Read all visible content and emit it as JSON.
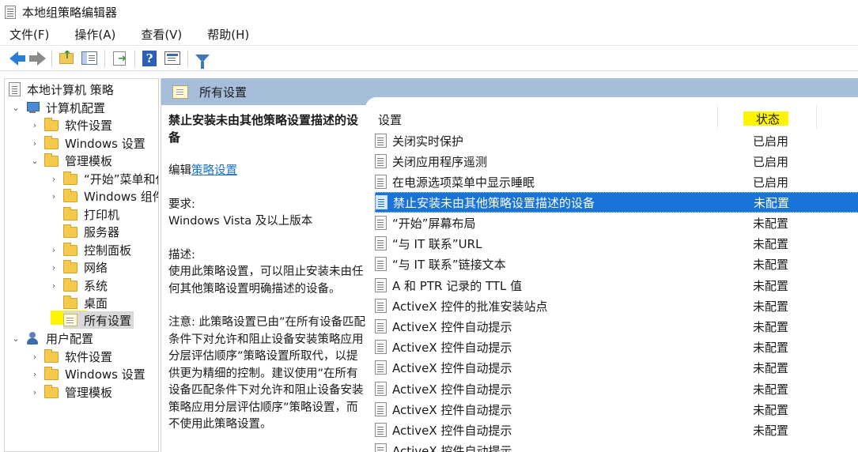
{
  "window": {
    "title": "本地组策略编辑器"
  },
  "menu": [
    "文件(F)",
    "操作(A)",
    "查看(V)",
    "帮助(H)"
  ],
  "toolbar": {
    "icons": [
      "back-arrow-icon",
      "forward-arrow-icon",
      "folder-up-icon",
      "show-hide-tree-icon",
      "export-list-icon",
      "help-icon",
      "properties-icon",
      "filter-icon"
    ]
  },
  "tree": {
    "root": "本地计算机 策略",
    "computer": "计算机配置",
    "c_software": "软件设置",
    "c_windows": "Windows 设置",
    "c_admin": "管理模板",
    "admin_children": [
      "“开始”菜单和任务栏",
      "Windows 组件",
      "打印机",
      "服务器",
      "控制面板",
      "网络",
      "系统",
      "桌面",
      "所有设置"
    ],
    "user": "用户配置",
    "u_software": "软件设置",
    "u_windows": "Windows 设置",
    "u_admin": "管理模板",
    "selected": "所有设置",
    "highlight_color": "#fff500"
  },
  "pane": {
    "header": "所有设置",
    "description": {
      "title": "禁止安装未由其他策略设置描述的设备",
      "edit_prefix": "编辑",
      "edit_link": "策略设置",
      "requirements_label": "要求:",
      "requirements": "Windows Vista 及以上版本",
      "desc_label": "描述:",
      "desc_text": "使用此策略设置，可以阻止安装未由任何其他策略设置明确描述的设备。",
      "note_text": "注意: 此策略设置已由”在所有设备匹配条件下对允许和阻止设备安装策略应用分层评估顺序”策略设置所取代，以提供更为精细的控制。建议使用”在所有设备匹配条件下对允许和阻止设备安装策略应用分层评估顺序”策略设置，而不使用此策略设置。"
    },
    "columns": {
      "setting": "设置",
      "status": "状态"
    },
    "rows": [
      {
        "name": "关闭实时保护",
        "state": "已启用"
      },
      {
        "name": "关闭应用程序遥测",
        "state": "已启用"
      },
      {
        "name": "在电源选项菜单中显示睡眠",
        "state": "已启用"
      },
      {
        "name": "禁止安装未由其他策略设置描述的设备",
        "state": "未配置"
      },
      {
        "name": "“开始”屏幕布局",
        "state": "未配置"
      },
      {
        "name": "“与 IT 联系”URL",
        "state": "未配置"
      },
      {
        "name": "“与 IT 联系”链接文本",
        "state": "未配置"
      },
      {
        "name": "A 和 PTR 记录的 TTL 值",
        "state": "未配置"
      },
      {
        "name": "ActiveX 控件的批准安装站点",
        "state": "未配置"
      },
      {
        "name": "ActiveX 控件自动提示",
        "state": "未配置"
      },
      {
        "name": "ActiveX 控件自动提示",
        "state": "未配置"
      },
      {
        "name": "ActiveX 控件自动提示",
        "state": "未配置"
      },
      {
        "name": "ActiveX 控件自动提示",
        "state": "未配置"
      },
      {
        "name": "ActiveX 控件自动提示",
        "state": "未配置"
      },
      {
        "name": "ActiveX 控件自动提示",
        "state": "未配置"
      },
      {
        "name": "ActiveX 控件自动提示",
        "state": ""
      }
    ],
    "selected_row": "禁止安装未由其他策略设置描述的设备",
    "selection_color": "#1a73d6"
  }
}
